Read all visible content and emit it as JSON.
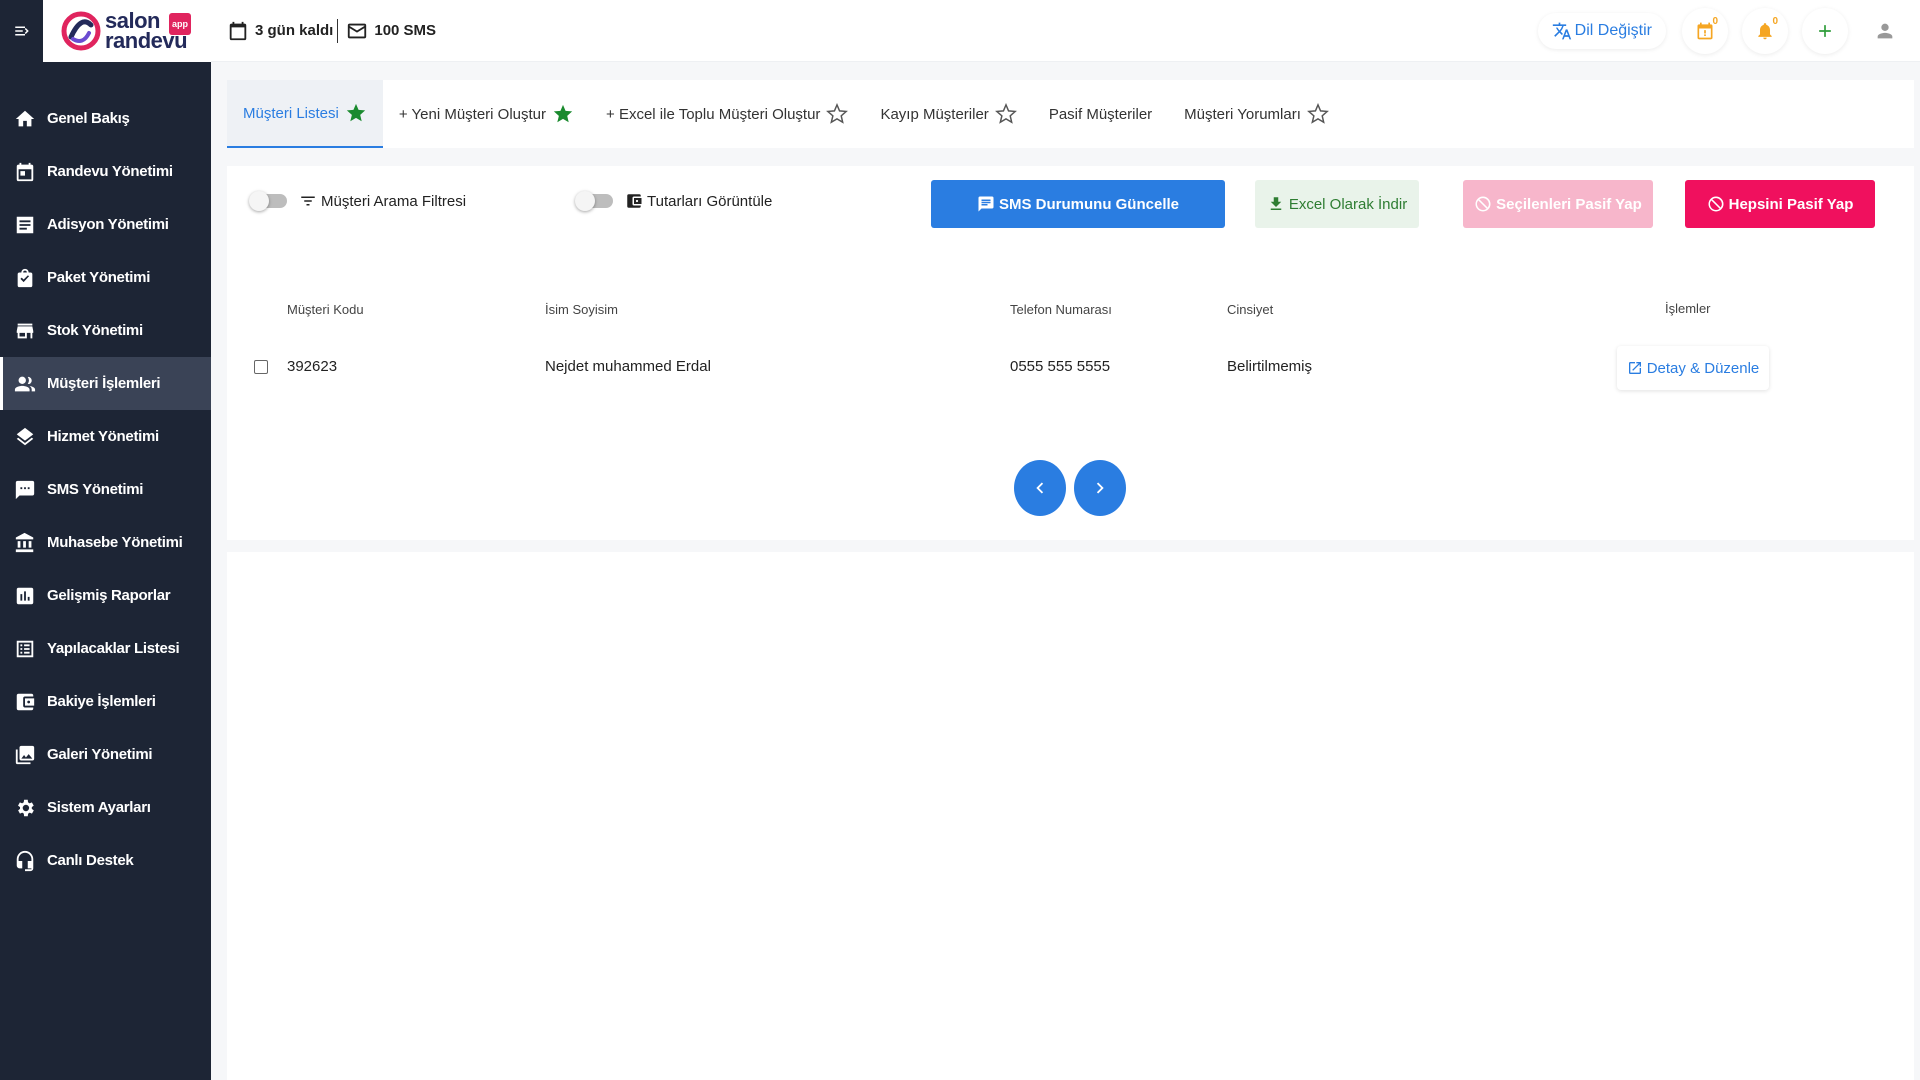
{
  "brand": {
    "line1": "salon",
    "line2": "randevu",
    "badge": "app"
  },
  "topbar": {
    "days_left": "3 gün kaldı",
    "sms_count": "100 SMS",
    "lang_label": "Dil Değiştir",
    "calendar_count": "0",
    "bell_count": "0"
  },
  "sidebar": {
    "items": [
      {
        "label": "Genel Bakış",
        "icon": "home-icon"
      },
      {
        "label": "Randevu Yönetimi",
        "icon": "calendar-icon"
      },
      {
        "label": "Adisyon Yönetimi",
        "icon": "receipt-icon"
      },
      {
        "label": "Paket Yönetimi",
        "icon": "bag-icon"
      },
      {
        "label": "Stok Yönetimi",
        "icon": "store-icon"
      },
      {
        "label": "Müşteri İşlemleri",
        "icon": "people-icon",
        "active": true
      },
      {
        "label": "Hizmet Yönetimi",
        "icon": "layers-icon"
      },
      {
        "label": "SMS Yönetimi",
        "icon": "chat-icon"
      },
      {
        "label": "Muhasebe Yönetimi",
        "icon": "bank-icon"
      },
      {
        "label": "Gelişmiş Raporlar",
        "icon": "chart-icon"
      },
      {
        "label": "Yapılacaklar Listesi",
        "icon": "list-icon"
      },
      {
        "label": "Bakiye İşlemleri",
        "icon": "wallet-icon"
      },
      {
        "label": "Galeri Yönetimi",
        "icon": "gallery-icon"
      },
      {
        "label": "Sistem Ayarları",
        "icon": "gear-icon"
      },
      {
        "label": "Canlı Destek",
        "icon": "headset-icon"
      }
    ]
  },
  "tabs": [
    {
      "label": "Müşteri Listesi",
      "star": "filled"
    },
    {
      "label": "+ Yeni Müşteri Oluştur",
      "star": "filled"
    },
    {
      "label": "+ Excel ile Toplu Müşteri Oluştur",
      "star": "outline"
    },
    {
      "label": "Kayıp Müşteriler",
      "star": "outline"
    },
    {
      "label": "Pasif Müşteriler",
      "star": "none"
    },
    {
      "label": "Müşteri Yorumları",
      "star": "outline"
    }
  ],
  "toolbar": {
    "filter_label": "Müşteri Arama Filtresi",
    "amounts_label": "Tutarları Görüntüle",
    "sms_btn": "SMS Durumunu Güncelle",
    "excel_btn": "Excel Olarak İndir",
    "selected_passive_btn": "Seçilenleri Pasif Yap",
    "all_passive_btn": "Hepsini Pasif Yap"
  },
  "table": {
    "headers": [
      "Müşteri Kodu",
      "İsim Soyisim",
      "Telefon Numarası",
      "Cinsiyet",
      "İşlemler"
    ],
    "rows": [
      {
        "code": "392623",
        "name": "Nejdet muhammed Erdal",
        "phone": "0555 555 5555",
        "gender": "Belirtilmemiş",
        "action": "Detay & Düzenle"
      }
    ]
  },
  "colors": {
    "primary": "#2a7de1",
    "sidebar": "#1d2535",
    "danger": "#f0105e",
    "danger_light": "#f7b6cb",
    "success": "#2e7d32",
    "star_green": "#1a8a2e"
  }
}
